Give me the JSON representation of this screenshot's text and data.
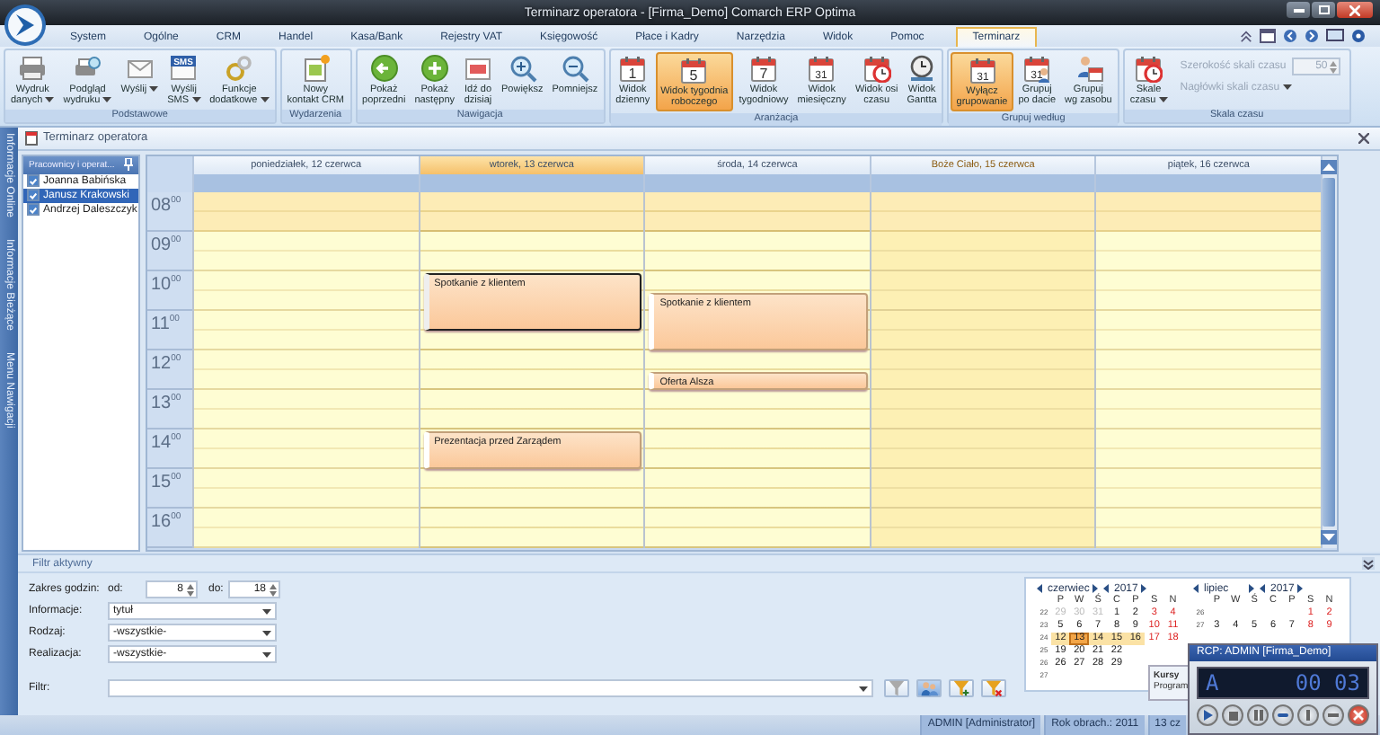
{
  "window": {
    "title": "Terminarz operatora - [Firma_Demo] Comarch ERP Optima"
  },
  "menu": [
    {
      "label": "System",
      "selected": false
    },
    {
      "label": "Ogólne",
      "selected": false
    },
    {
      "label": "CRM",
      "selected": false
    },
    {
      "label": "Handel",
      "selected": false
    },
    {
      "label": "Kasa/Bank",
      "selected": false
    },
    {
      "label": "Rejestry VAT",
      "selected": false
    },
    {
      "label": "Księgowość",
      "selected": false
    },
    {
      "label": "Płace i Kadry",
      "selected": false
    },
    {
      "label": "Narzędzia",
      "selected": false
    },
    {
      "label": "Widok",
      "selected": false
    },
    {
      "label": "Pomoc",
      "selected": false
    },
    {
      "label": "Terminarz",
      "selected": true
    }
  ],
  "ribbon": [
    {
      "title": "Podstawowe",
      "buttons": [
        {
          "label": "Wydruk\ndanych",
          "kind": "printer",
          "dropdown": true,
          "selected": false
        },
        {
          "label": "Podgląd\nwydruku",
          "kind": "preview",
          "dropdown": true,
          "selected": false
        },
        {
          "label": "Wyślij",
          "kind": "envelope",
          "dropdown": true,
          "selected": false
        },
        {
          "label": "Wyślij\nSMS",
          "kind": "sms",
          "icon_text": "SMS",
          "dropdown": true,
          "selected": false
        },
        {
          "label": "Funkcje\ndodatkowe",
          "kind": "gears",
          "dropdown": true,
          "selected": false
        }
      ]
    },
    {
      "title": "Wydarzenia",
      "buttons": [
        {
          "label": "Nowy\nkontakt CRM",
          "kind": "newdoc",
          "dropdown": false,
          "selected": false
        }
      ]
    },
    {
      "title": "Nawigacja",
      "buttons": [
        {
          "label": "Pokaż\npoprzedni",
          "kind": "prev",
          "dropdown": false,
          "selected": false
        },
        {
          "label": "Pokaż\nnastępny",
          "kind": "next",
          "dropdown": false,
          "selected": false
        },
        {
          "label": "Idź do\ndzisiaj",
          "kind": "today",
          "dropdown": false,
          "selected": false
        },
        {
          "label": "Powiększ",
          "kind": "zoomin",
          "dropdown": false,
          "selected": false
        },
        {
          "label": "Pomniejsz",
          "kind": "zoomout",
          "dropdown": false,
          "selected": false
        }
      ]
    },
    {
      "title": "Aranżacja",
      "buttons": [
        {
          "label": "Widok\ndzienny",
          "kind": "calendar",
          "icon_text": "1",
          "dropdown": false,
          "selected": false
        },
        {
          "label": "Widok tygodnia\nroboczego",
          "kind": "calendar",
          "icon_text": "5",
          "dropdown": false,
          "selected": true
        },
        {
          "label": "Widok\ntygodniowy",
          "kind": "calendar",
          "icon_text": "7",
          "dropdown": false,
          "selected": false
        },
        {
          "label": "Widok\nmiesięczny",
          "kind": "calendar",
          "icon_text": "31",
          "dropdown": false,
          "selected": false
        },
        {
          "label": "Widok osi\nczasu",
          "kind": "clockcal",
          "dropdown": false,
          "selected": false
        },
        {
          "label": "Widok\nGantta",
          "kind": "clock",
          "dropdown": false,
          "selected": false
        }
      ]
    },
    {
      "title": "Grupuj według",
      "buttons": [
        {
          "label": "Wyłącz\ngrupowanie",
          "kind": "calendar",
          "icon_text": "31",
          "dropdown": false,
          "selected": true
        },
        {
          "label": "Grupuj\npo dacie",
          "kind": "calperson",
          "icon_text": "31",
          "dropdown": false,
          "selected": false
        },
        {
          "label": "Grupuj\nwg zasobu",
          "kind": "personcal",
          "dropdown": false,
          "selected": false
        }
      ]
    },
    {
      "title": "Skala czasu",
      "buttons": [
        {
          "label": "Skale\nczasu",
          "kind": "clockcal",
          "dropdown": true,
          "selected": false
        }
      ],
      "fields": [
        {
          "kind": "spin",
          "label": "Szerokość skali czasu",
          "value": "50",
          "disabled": true
        },
        {
          "kind": "menu",
          "label": "Nagłówki skali czasu",
          "disabled": true
        }
      ]
    }
  ],
  "document_tab": {
    "title": "Terminarz operatora"
  },
  "side_strip": [
    "Informacje Online",
    "Informacje Bieżące",
    "Menu Nawigacji"
  ],
  "resources": {
    "title": "Pracownicy i operat...",
    "items": [
      {
        "name": "Joanna Babińska",
        "checked": true,
        "selected": false
      },
      {
        "name": "Janusz Krakowski",
        "checked": true,
        "selected": true
      },
      {
        "name": "Andrzej Daleszczyk",
        "checked": true,
        "selected": false
      }
    ]
  },
  "calendar": {
    "hours": [
      {
        "label": "08$^{00}$",
        "working": false
      },
      {
        "label": "09$^{00}$",
        "working": true
      },
      {
        "label": "10$^{00}$",
        "working": true
      },
      {
        "label": "11$^{00}$",
        "working": true
      },
      {
        "label": "12$^{00}$",
        "working": true
      },
      {
        "label": "13$^{00}$",
        "working": true
      },
      {
        "label": "14$^{00}$",
        "working": true
      },
      {
        "label": "15$^{00}$",
        "working": true
      },
      {
        "label": "16$^{00}$",
        "working": true
      }
    ],
    "days": [
      {
        "label": "poniedziałek, 12 czerwca",
        "today": false,
        "holiday": false
      },
      {
        "label": "wtorek, 13 czerwca",
        "today": true,
        "holiday": false,
        "appointments": [
          {
            "title": "Spotkanie z klientem",
            "selected": true
          },
          {
            "title": "Prezentacja przed Zarządem",
            "selected": false
          }
        ]
      },
      {
        "label": "środa, 14 czerwca",
        "today": false,
        "holiday": false,
        "appointments": [
          {
            "title": "Spotkanie z klientem",
            "selected": false
          },
          {
            "title": "Oferta Alsza",
            "selected": false
          }
        ]
      },
      {
        "label": "Boże Ciało, 15 czerwca",
        "today": false,
        "holiday": true
      },
      {
        "label": "piątek, 16 czerwca",
        "today": false,
        "holiday": false
      }
    ]
  },
  "filter": {
    "title": "Filtr aktywny",
    "hours_label": "Zakres godzin:",
    "from_label": "od:",
    "from": "8",
    "to_label": "do:",
    "to": "18",
    "selects": [
      {
        "label": "Informacje:",
        "value": "tytuł"
      },
      {
        "label": "Rodzaj:",
        "value": "-wszystkie-"
      },
      {
        "label": "Realizacja:",
        "value": "-wszystkie-"
      }
    ],
    "filter_label": "Filtr:",
    "tools": [
      {
        "kind": "funnel",
        "selected": false
      },
      {
        "kind": "people",
        "selected": true
      },
      {
        "kind": "funnel-plus",
        "selected": false
      },
      {
        "kind": "funnel-cross",
        "selected": false
      }
    ]
  },
  "months": [
    {
      "month": "czerwiec",
      "year": "2017",
      "weekdays": [
        "P",
        "W",
        "Ś",
        "C",
        "P",
        "S",
        "N"
      ],
      "weeks": [
        {
          "week": "22",
          "days": [
            {
              "text": "29",
              "muted": true,
              "selected": false,
              "today": false
            },
            {
              "text": "30",
              "muted": true,
              "selected": false,
              "today": false
            },
            {
              "text": "31",
              "muted": true,
              "selected": false,
              "today": false
            },
            {
              "text": "1",
              "muted": false,
              "selected": false,
              "today": false
            },
            {
              "text": "2",
              "muted": false,
              "selected": false,
              "today": false
            },
            {
              "text": "3",
              "muted": false,
              "selected": false,
              "today": false
            },
            {
              "text": "4",
              "muted": false,
              "selected": false,
              "today": false
            }
          ]
        },
        {
          "week": "23",
          "days": [
            {
              "text": "5",
              "muted": false,
              "selected": false,
              "today": false
            },
            {
              "text": "6",
              "muted": false,
              "selected": false,
              "today": false
            },
            {
              "text": "7",
              "muted": false,
              "selected": false,
              "today": false
            },
            {
              "text": "8",
              "muted": false,
              "selected": false,
              "today": false
            },
            {
              "text": "9",
              "muted": false,
              "selected": false,
              "today": false
            },
            {
              "text": "10",
              "muted": false,
              "selected": false,
              "today": false
            },
            {
              "text": "11",
              "muted": false,
              "selected": false,
              "today": false
            }
          ]
        },
        {
          "week": "24",
          "days": [
            {
              "text": "12",
              "muted": false,
              "selected": true,
              "today": false
            },
            {
              "text": "13",
              "muted": false,
              "selected": true,
              "today": true
            },
            {
              "text": "14",
              "muted": false,
              "selected": true,
              "today": false
            },
            {
              "text": "15",
              "muted": false,
              "selected": true,
              "today": false
            },
            {
              "text": "16",
              "muted": false,
              "selected": true,
              "today": false
            },
            {
              "text": "17",
              "muted": false,
              "selected": false,
              "today": false
            },
            {
              "text": "18",
              "muted": false,
              "selected": false,
              "today": false
            }
          ]
        },
        {
          "week": "25",
          "days": [
            {
              "text": "19",
              "muted": false,
              "selected": false,
              "today": false
            },
            {
              "text": "20",
              "muted": false,
              "selected": false,
              "today": false
            },
            {
              "text": "21",
              "muted": false,
              "selected": false,
              "today": false
            },
            {
              "text": "22",
              "muted": false,
              "selected": false,
              "today": false
            }
          ]
        },
        {
          "week": "26",
          "days": [
            {
              "text": "26",
              "muted": false,
              "selected": false,
              "today": false
            },
            {
              "text": "27",
              "muted": false,
              "selected": false,
              "today": false
            },
            {
              "text": "28",
              "muted": false,
              "selected": false,
              "today": false
            },
            {
              "text": "29",
              "muted": false,
              "selected": false,
              "today": false
            }
          ]
        },
        {
          "week": "27"
        }
      ]
    },
    {
      "month": "lipiec",
      "year": "2017",
      "weekdays": [
        "P",
        "W",
        "Ś",
        "C",
        "P",
        "S",
        "N"
      ],
      "weeks": [
        {
          "week": "26",
          "days": [
            {
              "text": "1",
              "muted": false,
              "selected": false,
              "today": false
            },
            {
              "text": "2",
              "muted": false,
              "selected": false,
              "today": false
            }
          ]
        },
        {
          "week": "27",
          "days": [
            {
              "text": "3",
              "muted": false,
              "selected": false,
              "today": false
            },
            {
              "text": "4",
              "muted": false,
              "selected": false,
              "today": false
            },
            {
              "text": "5",
              "muted": false,
              "selected": false,
              "today": false
            },
            {
              "text": "6",
              "muted": false,
              "selected": false,
              "today": false
            },
            {
              "text": "7",
              "muted": false,
              "selected": false,
              "today": false
            },
            {
              "text": "8",
              "muted": false,
              "selected": false,
              "today": false
            },
            {
              "text": "9",
              "muted": false,
              "selected": false,
              "today": false
            }
          ]
        }
      ]
    }
  ],
  "tooltip": {
    "title": "Kursy",
    "text": "Program"
  },
  "rcp": {
    "title": "RCP: ADMIN [Firma_Demo]",
    "display_left": "A",
    "display_right": "00 03",
    "buttons": [
      {
        "kind": "play"
      },
      {
        "kind": "stop"
      },
      {
        "kind": "pause"
      },
      {
        "kind": "dot"
      },
      {
        "kind": "info"
      },
      {
        "kind": "minus"
      },
      {
        "kind": "close"
      }
    ]
  },
  "status_bar": [
    "ADMIN [Administrator]",
    "Rok obrach.: 2011",
    "13 cz"
  ]
}
